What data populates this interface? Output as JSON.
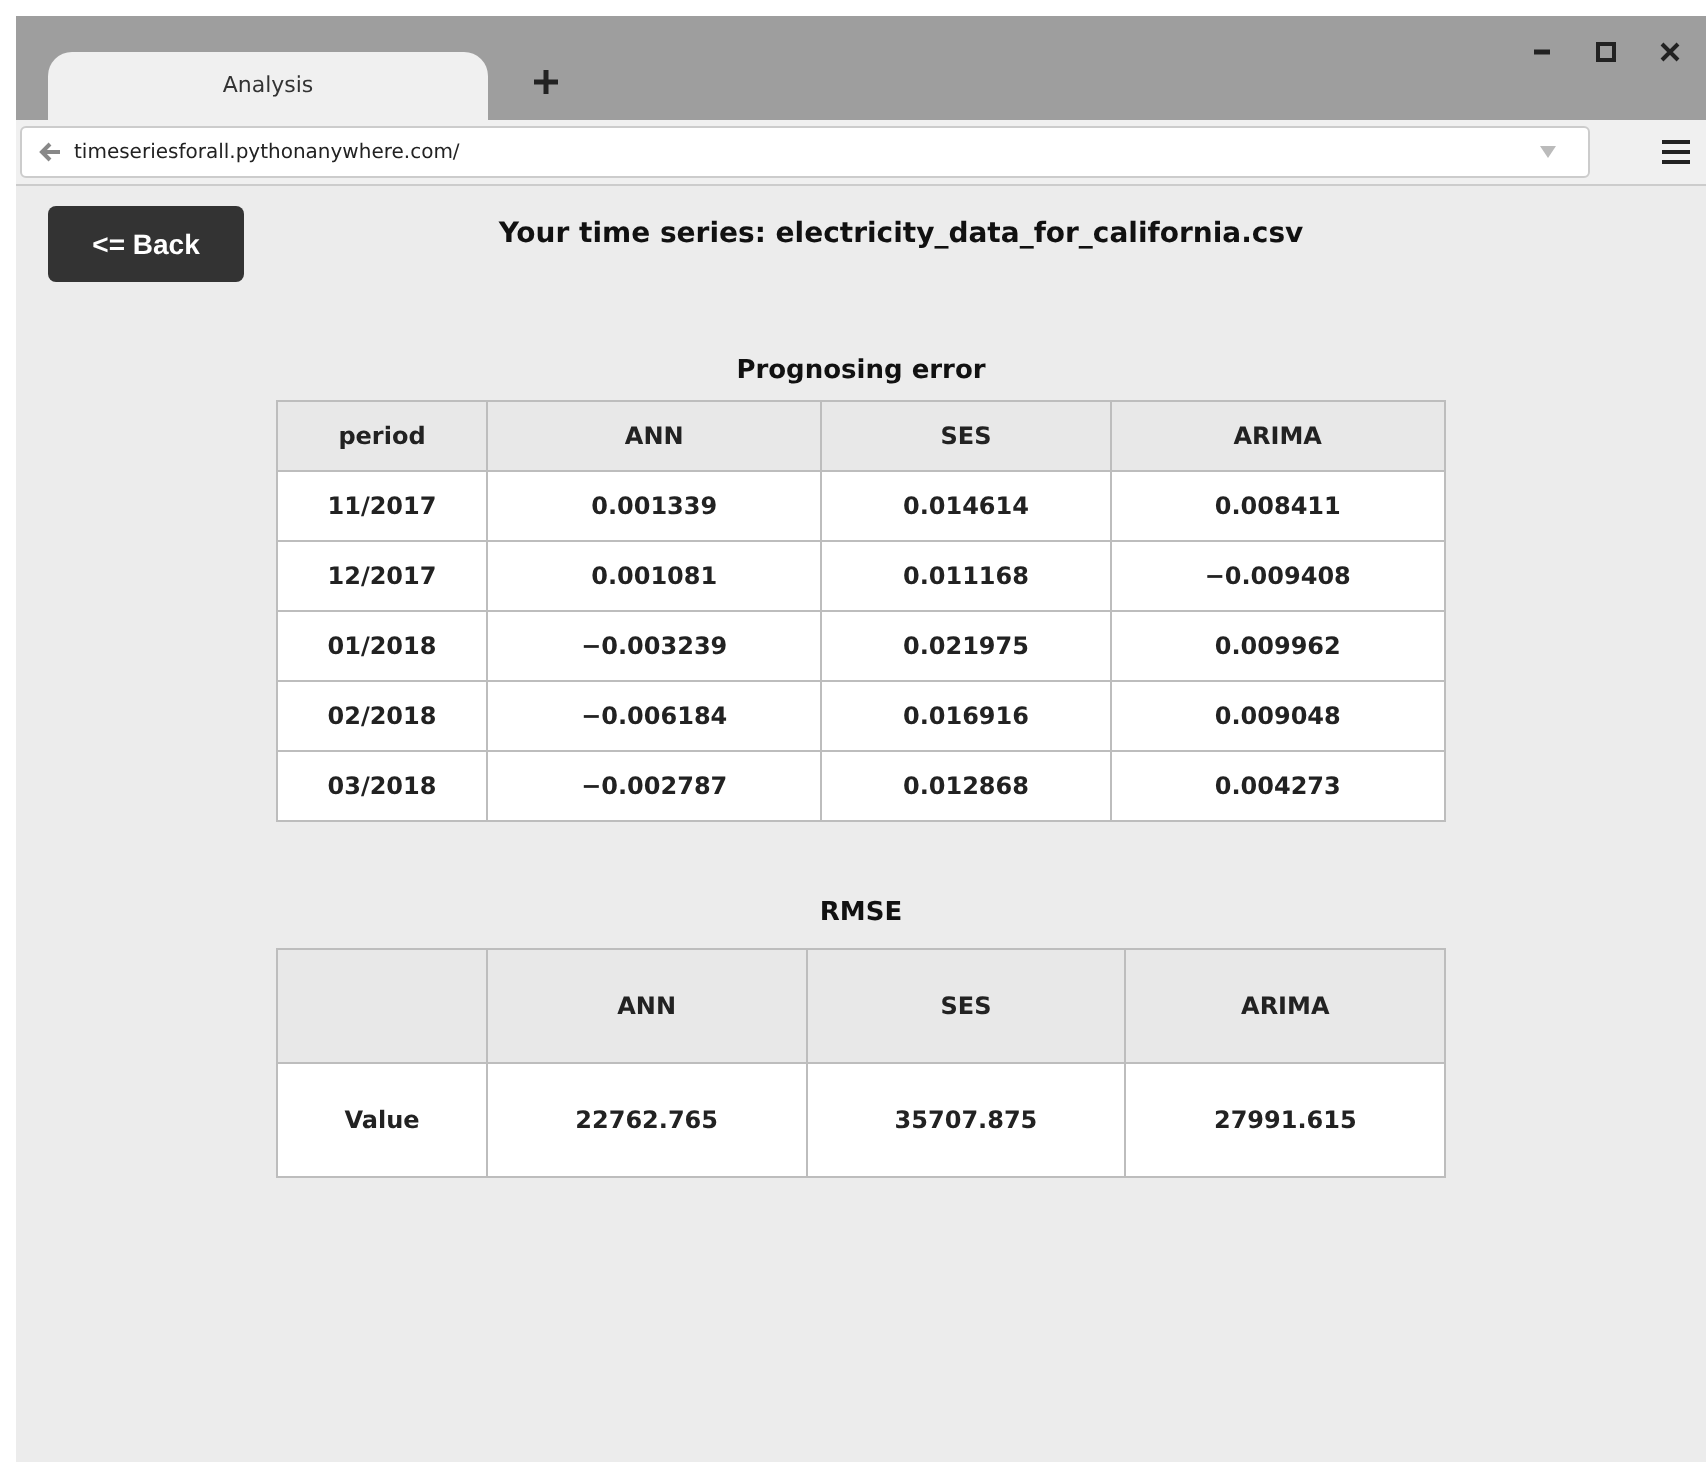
{
  "browser": {
    "tab": {
      "title": "Analysis",
      "selected": true
    },
    "address": "timeseriesforall.pythonanywhere.com/"
  },
  "back_button": "<= Back",
  "heading": "Your time series: electricity_data_for_california.csv",
  "error_table": {
    "title": "Prognosing error",
    "columns": [
      "period",
      "ANN",
      "SES",
      "ARIMA"
    ],
    "rows": [
      [
        "11/2017",
        "0.001339",
        "0.014614",
        "0.008411"
      ],
      [
        "12/2017",
        "0.001081",
        "0.011168",
        "−0.009408"
      ],
      [
        "01/2018",
        "−0.003239",
        "0.021975",
        "0.009962"
      ],
      [
        "02/2018",
        "−0.006184",
        "0.016916",
        "0.009048"
      ],
      [
        "03/2018",
        "−0.002787",
        "0.012868",
        "0.004273"
      ]
    ]
  },
  "rmse_table": {
    "title": "RMSE",
    "columns": [
      "ANN",
      "SES",
      "ARIMA"
    ],
    "rows": [
      {
        "label": "Value",
        "values": [
          "22762.765",
          "35707.875",
          "27991.615"
        ]
      }
    ]
  }
}
